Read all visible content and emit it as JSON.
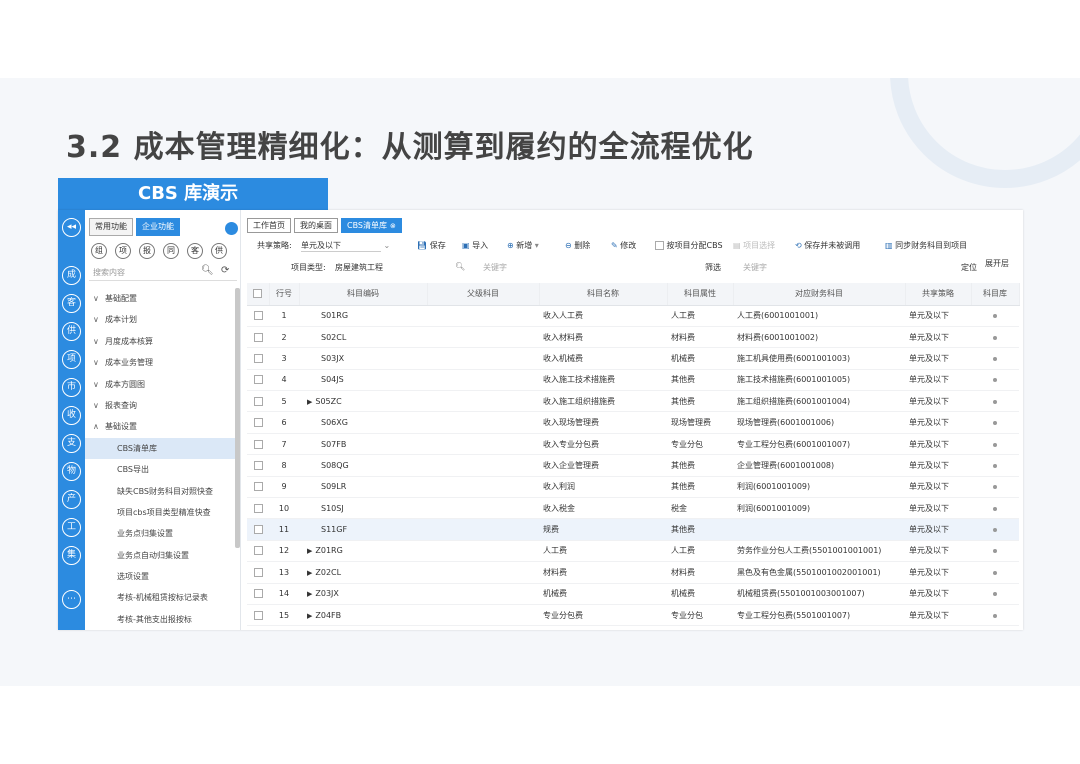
{
  "slide": {
    "title": "3.2  成本管理精细化：从测算到履约的全流程优化",
    "banner": "CBS 库演示"
  },
  "rail": {
    "buttons": [
      "◂◂",
      "成",
      "客",
      "供",
      "项",
      "市",
      "收",
      "支",
      "物",
      "产",
      "工",
      "集",
      "⋯"
    ]
  },
  "menu": {
    "tabs": [
      "常用功能",
      "企业功能"
    ],
    "quick": [
      "组",
      "项",
      "报",
      "同",
      "客",
      "供"
    ],
    "search_placeholder": "搜索内容",
    "items": [
      {
        "label": "基础配置",
        "chev": "∨",
        "sub": false
      },
      {
        "label": "成本计划",
        "chev": "∨",
        "sub": false
      },
      {
        "label": "月度成本核算",
        "chev": "∨",
        "sub": false
      },
      {
        "label": "成本业务管理",
        "chev": "∨",
        "sub": false
      },
      {
        "label": "成本方圆图",
        "chev": "∨",
        "sub": false
      },
      {
        "label": "报表查询",
        "chev": "∨",
        "sub": false
      },
      {
        "label": "基础设置",
        "chev": "∧",
        "sub": false
      },
      {
        "label": "CBS清单库",
        "chev": "",
        "sub": true,
        "selected": true
      },
      {
        "label": "CBS导出",
        "chev": "",
        "sub": true
      },
      {
        "label": "缺失CBS财务科目对照快查",
        "chev": "",
        "sub": true
      },
      {
        "label": "项目cbs项目类型精准快查",
        "chev": "",
        "sub": true
      },
      {
        "label": "业务点归集设置",
        "chev": "",
        "sub": true
      },
      {
        "label": "业务点自动归集设置",
        "chev": "",
        "sub": true
      },
      {
        "label": "选项设置",
        "chev": "",
        "sub": true
      },
      {
        "label": "考核-机械租赁按标记录表",
        "chev": "",
        "sub": true
      },
      {
        "label": "考核-其他支出报按标",
        "chev": "",
        "sub": true
      }
    ]
  },
  "doc_tabs": [
    {
      "label": "工作首页",
      "active": false
    },
    {
      "label": "我的桌面",
      "active": false
    },
    {
      "label": "CBS清单库",
      "active": true
    }
  ],
  "toolbar": {
    "share_label": "共享策略:",
    "share_value": "单元及以下",
    "save": "保存",
    "import": "导入",
    "add": "新增",
    "delete": "删除",
    "edit": "修改",
    "assign_cbs": "按项目分配CBS",
    "project_select": "项目选择",
    "save_unmatched": "保存并未被调用",
    "sync_finance": "同步财务科目到项目"
  },
  "filter": {
    "project_type_label": "项目类型:",
    "project_type_value": "房屋建筑工程",
    "keyword_placeholder": "关键字",
    "filter_label": "筛选",
    "keyword2_placeholder": "关键字",
    "locate": "定位",
    "expand": "展开层"
  },
  "table": {
    "columns": [
      "",
      "行号",
      "科目编码",
      "父级科目",
      "科目名称",
      "科目属性",
      "对应财务科目",
      "共享策略",
      "科目库"
    ],
    "rows": [
      {
        "no": "1",
        "code": "S01RG",
        "expand": false,
        "parent": "",
        "name": "收入人工费",
        "attr": "人工费",
        "finance": "人工费(6001001001)",
        "share": "单元及以下"
      },
      {
        "no": "2",
        "code": "S02CL",
        "expand": false,
        "parent": "",
        "name": "收入材料费",
        "attr": "材料费",
        "finance": "材料费(6001001002)",
        "share": "单元及以下"
      },
      {
        "no": "3",
        "code": "S03JX",
        "expand": false,
        "parent": "",
        "name": "收入机械费",
        "attr": "机械费",
        "finance": "施工机具使用费(6001001003)",
        "share": "单元及以下"
      },
      {
        "no": "4",
        "code": "S04JS",
        "expand": false,
        "parent": "",
        "name": "收入施工技术措施费",
        "attr": "其他费",
        "finance": "施工技术措施费(6001001005)",
        "share": "单元及以下"
      },
      {
        "no": "5",
        "code": "S05ZC",
        "expand": true,
        "parent": "",
        "name": "收入施工组织措施费",
        "attr": "其他费",
        "finance": "施工组织措施费(6001001004)",
        "share": "单元及以下"
      },
      {
        "no": "6",
        "code": "S06XG",
        "expand": false,
        "parent": "",
        "name": "收入现场管理费",
        "attr": "现场管理费",
        "finance": "现场管理费(6001001006)",
        "share": "单元及以下"
      },
      {
        "no": "7",
        "code": "S07FB",
        "expand": false,
        "parent": "",
        "name": "收入专业分包费",
        "attr": "专业分包",
        "finance": "专业工程分包费(6001001007)",
        "share": "单元及以下"
      },
      {
        "no": "8",
        "code": "S08QG",
        "expand": false,
        "parent": "",
        "name": "收入企业管理费",
        "attr": "其他费",
        "finance": "企业管理费(6001001008)",
        "share": "单元及以下"
      },
      {
        "no": "9",
        "code": "S09LR",
        "expand": false,
        "parent": "",
        "name": "收入利润",
        "attr": "其他费",
        "finance": "利润(6001001009)",
        "share": "单元及以下"
      },
      {
        "no": "10",
        "code": "S10SJ",
        "expand": false,
        "parent": "",
        "name": "收入税金",
        "attr": "税金",
        "finance": "利润(6001001009)",
        "share": "单元及以下"
      },
      {
        "no": "11",
        "code": "S11GF",
        "expand": false,
        "parent": "",
        "name": "规费",
        "attr": "其他费",
        "finance": "",
        "share": "单元及以下"
      },
      {
        "no": "12",
        "code": "Z01RG",
        "expand": true,
        "parent": "",
        "name": "人工费",
        "attr": "人工费",
        "finance": "劳务作业分包人工费(5501001001001)",
        "share": "单元及以下"
      },
      {
        "no": "13",
        "code": "Z02CL",
        "expand": true,
        "parent": "",
        "name": "材料费",
        "attr": "材料费",
        "finance": "黑色及有色金属(5501001002001001)",
        "share": "单元及以下"
      },
      {
        "no": "14",
        "code": "Z03JX",
        "expand": true,
        "parent": "",
        "name": "机械费",
        "attr": "机械费",
        "finance": "机械租赁费(5501001003001007)",
        "share": "单元及以下"
      },
      {
        "no": "15",
        "code": "Z04FB",
        "expand": true,
        "parent": "",
        "name": "专业分包费",
        "attr": "专业分包",
        "finance": "专业工程分包费(5501001007)",
        "share": "单元及以下"
      }
    ],
    "highlight_row": 11
  }
}
